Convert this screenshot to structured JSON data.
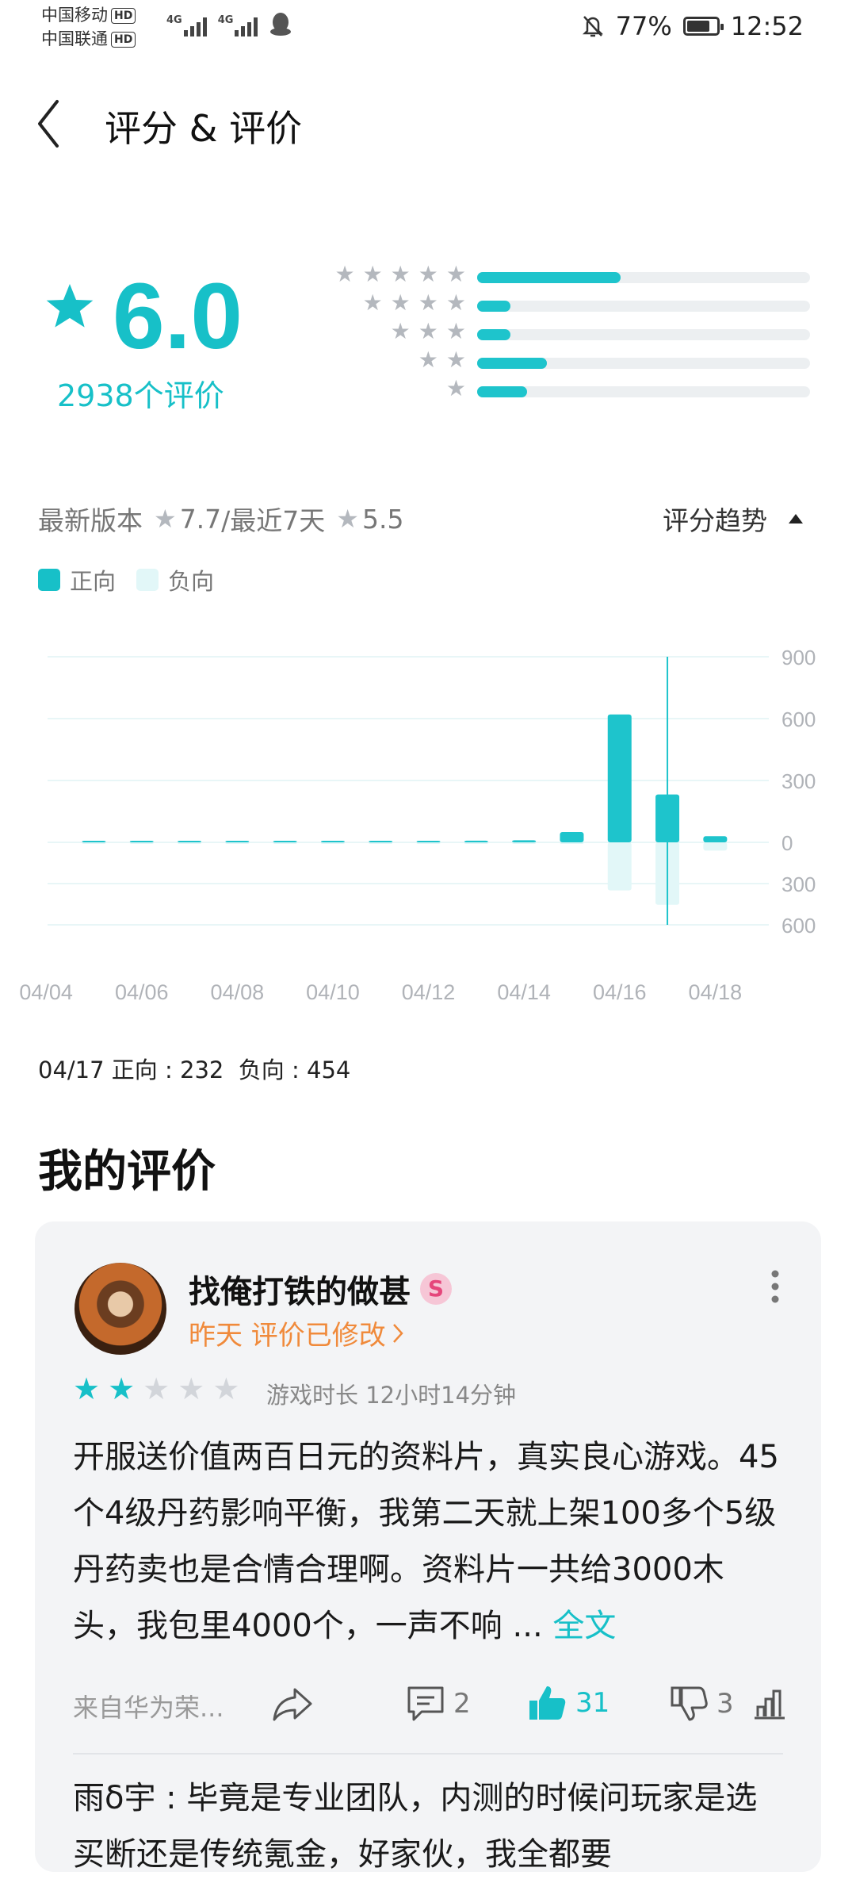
{
  "status_bar": {
    "carrier1": "中国移动",
    "carrier2": "中国联通",
    "hd": "HD",
    "net": "4G",
    "battery_pct": "77%",
    "battery_level": 0.77,
    "time": "12:52"
  },
  "header": {
    "title": "评分 & 评价"
  },
  "rating": {
    "score": "6.0",
    "count_text": "2938个评价",
    "distribution": [
      {
        "stars": 5,
        "fraction": 0.43
      },
      {
        "stars": 4,
        "fraction": 0.1
      },
      {
        "stars": 3,
        "fraction": 0.1
      },
      {
        "stars": 2,
        "fraction": 0.21
      },
      {
        "stars": 1,
        "fraction": 0.15
      }
    ]
  },
  "version_line": {
    "latest_label": "最新版本",
    "latest_score": "7.7",
    "sep": "/最近7天",
    "recent_score": "5.5",
    "trend_label": "评分趋势"
  },
  "legend": {
    "positive": "正向",
    "negative": "负向"
  },
  "colors": {
    "accent": "#17c0c8",
    "negative": "#e2f7f8",
    "orange": "#f08a3b"
  },
  "chart_data": {
    "type": "bar",
    "categories": [
      "04/04",
      "04/05",
      "04/06",
      "04/07",
      "04/08",
      "04/09",
      "04/10",
      "04/11",
      "04/12",
      "04/13",
      "04/14",
      "04/15",
      "04/16",
      "04/17",
      "04/18"
    ],
    "x_tick_labels": [
      "04/04",
      "04/06",
      "04/08",
      "04/10",
      "04/12",
      "04/14",
      "04/16",
      "04/18"
    ],
    "series": [
      {
        "name": "正向",
        "values": [
          null,
          5,
          5,
          6,
          6,
          4,
          4,
          4,
          5,
          8,
          10,
          50,
          620,
          232,
          30
        ]
      },
      {
        "name": "负向",
        "values": [
          null,
          1,
          1,
          1,
          1,
          1,
          1,
          1,
          1,
          1,
          2,
          5,
          350,
          454,
          60
        ]
      }
    ],
    "y_ticks_positive": [
      "900",
      "600",
      "300",
      "0"
    ],
    "y_ticks_negative": [
      "300",
      "600"
    ],
    "ylim": [
      -600,
      900
    ],
    "selected_category": "04/17"
  },
  "chart_tooltip": "04/17 正向 : 232  负向 : 454",
  "my_review": {
    "section_title": "我的评价",
    "username": "找俺打铁的做甚",
    "badge": "S",
    "time_edit": "昨天 评价已修改",
    "stars_filled": 2,
    "stars_total": 5,
    "playtime": "游戏时长 12小时14分钟",
    "text": "开服送价值两百日元的资料片，真实良心游戏。45个4级丹药影响平衡，我第二天就上架100多个5级丹药卖也是合情合理啊。资料片一共给3000木头，我包里4000个，一声不响 ...",
    "more": "全文",
    "device": "来自华为荣...",
    "comments": "2",
    "likes": "31",
    "dislikes": "3",
    "reply": "雨δ宇 : 毕竟是专业团队，内测的时候问玩家是选买断还是传统氪金，好家伙，我全都要"
  }
}
